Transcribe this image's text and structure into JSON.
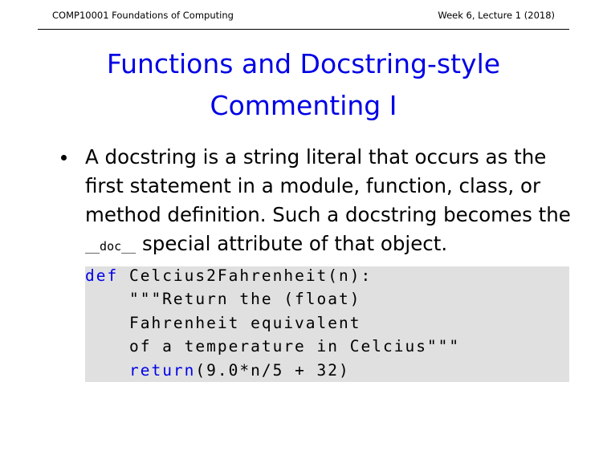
{
  "header": {
    "course": "COMP10001 Foundations of Computing",
    "week": "Week 6, Lecture 1 (2018)"
  },
  "title": {
    "line1": "Functions and Docstring-style",
    "line2": "Commenting I"
  },
  "bullet": {
    "line1": "A docstring is a string literal that occurs as the",
    "line2": "first statement in a module, function, class, or",
    "line3": "method definition. Such a docstring becomes the",
    "attr": "__doc__",
    "line4_rest": " special attribute of that object."
  },
  "code": {
    "kw_def": "def",
    "l1_rest": " Celcius2Fahrenheit(n):",
    "l2": "    \"\"\"Return the (float)",
    "l3": "    Fahrenheit equivalent",
    "l4": "    of a temperature in Celcius\"\"\"",
    "l5_indent": "    ",
    "kw_return": "return",
    "l5_rest": "(9.0*n/5 + 32)"
  }
}
